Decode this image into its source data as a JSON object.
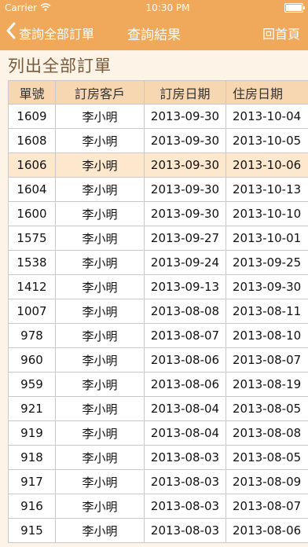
{
  "status": {
    "carrier": "Carrier",
    "time": "10:30 PM"
  },
  "nav": {
    "back_label": "查詢全部訂單",
    "title": "查詢結果",
    "home_label": "回首頁"
  },
  "section_title": "列出全部訂單",
  "table": {
    "headers": [
      "單號",
      "訂房客戶",
      "訂房日期",
      "住房日期"
    ],
    "selected_index": 2,
    "rows": [
      [
        "1609",
        "李小明",
        "2013-09-30",
        "2013-10-04"
      ],
      [
        "1608",
        "李小明",
        "2013-09-30",
        "2013-10-05"
      ],
      [
        "1606",
        "李小明",
        "2013-09-30",
        "2013-10-06"
      ],
      [
        "1604",
        "李小明",
        "2013-09-30",
        "2013-10-13"
      ],
      [
        "1600",
        "李小明",
        "2013-09-30",
        "2013-10-10"
      ],
      [
        "1575",
        "李小明",
        "2013-09-27",
        "2013-10-01"
      ],
      [
        "1538",
        "李小明",
        "2013-09-24",
        "2013-09-25"
      ],
      [
        "1412",
        "李小明",
        "2013-09-13",
        "2013-09-30"
      ],
      [
        "1007",
        "李小明",
        "2013-08-08",
        "2013-08-11"
      ],
      [
        "978",
        "李小明",
        "2013-08-07",
        "2013-08-10"
      ],
      [
        "960",
        "李小明",
        "2013-08-06",
        "2013-08-07"
      ],
      [
        "959",
        "李小明",
        "2013-08-06",
        "2013-08-19"
      ],
      [
        "921",
        "李小明",
        "2013-08-04",
        "2013-08-05"
      ],
      [
        "919",
        "李小明",
        "2013-08-04",
        "2013-08-08"
      ],
      [
        "918",
        "李小明",
        "2013-08-03",
        "2013-08-05"
      ],
      [
        "917",
        "李小明",
        "2013-08-03",
        "2013-08-09"
      ],
      [
        "916",
        "李小明",
        "2013-08-03",
        "2013-08-07"
      ],
      [
        "915",
        "李小明",
        "2013-08-03",
        "2013-08-06"
      ]
    ]
  },
  "icons": {
    "back": "chevron-left-icon",
    "wifi": "wifi-icon",
    "battery": "battery-icon"
  },
  "colors": {
    "bar": "#f0a95b",
    "header": "#f7d6b2",
    "selected": "#fde8ce",
    "background": "#fdf3e6"
  }
}
